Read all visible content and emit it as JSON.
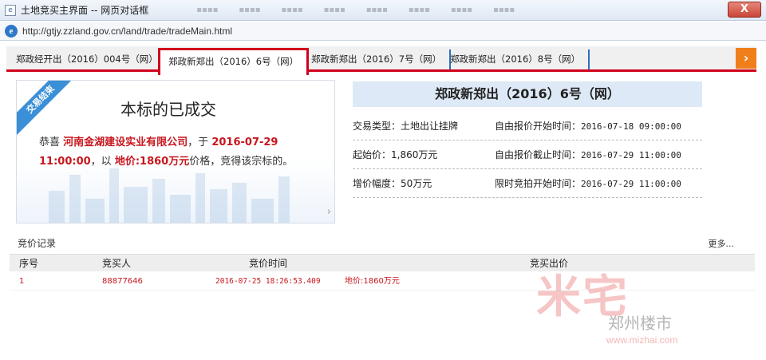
{
  "window": {
    "title": "土地竞买主界面 -- 网页对话框",
    "close_label": "X"
  },
  "address": {
    "url": "http://gtjy.zzland.gov.cn/land/trade/tradeMain.html"
  },
  "tabs": [
    {
      "label": "郑政经开出（2016）004号（网）",
      "active": false
    },
    {
      "label": "郑政新郑出（2016）6号（网）",
      "active": true
    },
    {
      "label": "郑政新郑出（2016）7号（网）",
      "active": false
    },
    {
      "label": "郑政新郑出（2016）8号（网）",
      "active": false
    }
  ],
  "next_tab_icon": "›",
  "result": {
    "ribbon": "交易结束",
    "heading": "本标的已成交",
    "congrats_prefix": "恭喜",
    "company": "河南金湖建设实业有限公司",
    "sep1": "，于",
    "deal_time": "2016-07-29 11:00:00",
    "sep2": "，以",
    "price": "地价:1860万元",
    "suffix": "价格，竞得该宗标的。",
    "chevron": "›"
  },
  "info": {
    "title": "郑政新郑出（2016）6号（网）",
    "rows": [
      {
        "left": "交易类型：土地出让挂牌",
        "right_label": "自由报价开始时间：",
        "right_value": "2016-07-18 09:00:00"
      },
      {
        "left": "起始价：1,860万元",
        "right_label": "自由报价截止时间：",
        "right_value": "2016-07-29 11:00:00"
      },
      {
        "left": "增价幅度：50万元",
        "right_label": "限时竞拍开始时间：",
        "right_value": "2016-07-29 11:00:00"
      }
    ]
  },
  "records": {
    "label": "竞价记录",
    "more": "更多...",
    "headers": [
      "序号",
      "竞买人",
      "竞价时间",
      "竞买出价"
    ],
    "rows": [
      {
        "index": "1",
        "bidder": "88877646",
        "time": "2016-07-25 18:26:53.409",
        "price": "地价:1860万元"
      }
    ]
  },
  "watermark": {
    "logo": "米宅",
    "weibo": "郑州楼市",
    "url": "www.mizhai.com"
  },
  "colors": {
    "accent_red": "#d0021b",
    "tab_separator_blue": "#2d6fc1",
    "next_button_orange": "#f07f1b",
    "info_title_bg": "#dde9f6"
  }
}
